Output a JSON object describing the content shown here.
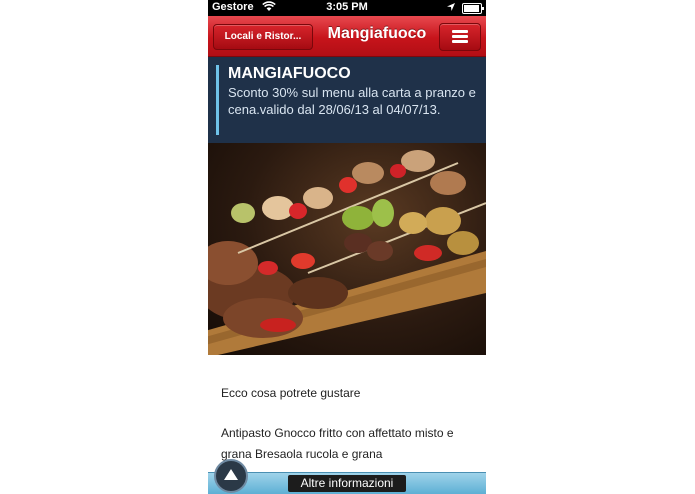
{
  "status_bar": {
    "carrier": "Gestore",
    "time": "3:05 PM"
  },
  "nav": {
    "back_label": "Locali e Ristor...",
    "title": "Mangiafuoco"
  },
  "promo": {
    "title": "MANGIAFUOCO",
    "text": "Sconto 30% sul menu alla carta a pranzo e cena.valido dal 28/06/13 al 04/07/13."
  },
  "content": {
    "intro": "Ecco cosa potrete gustare",
    "description": "Antipasto Gnocco fritto con affettato misto e grana Bresaola rucola e grana"
  },
  "bottom_bar": {
    "more_info_label": "Altre informazioni"
  },
  "colors": {
    "nav_red": "#c7141b",
    "promo_bg": "#1f3149",
    "accent_blue": "#6fc3ea"
  },
  "icons": {
    "wifi": "wifi-icon",
    "location": "location-arrow-icon",
    "battery": "battery-icon",
    "menu": "hamburger-menu-icon",
    "scroll_up": "chevron-up-icon"
  }
}
